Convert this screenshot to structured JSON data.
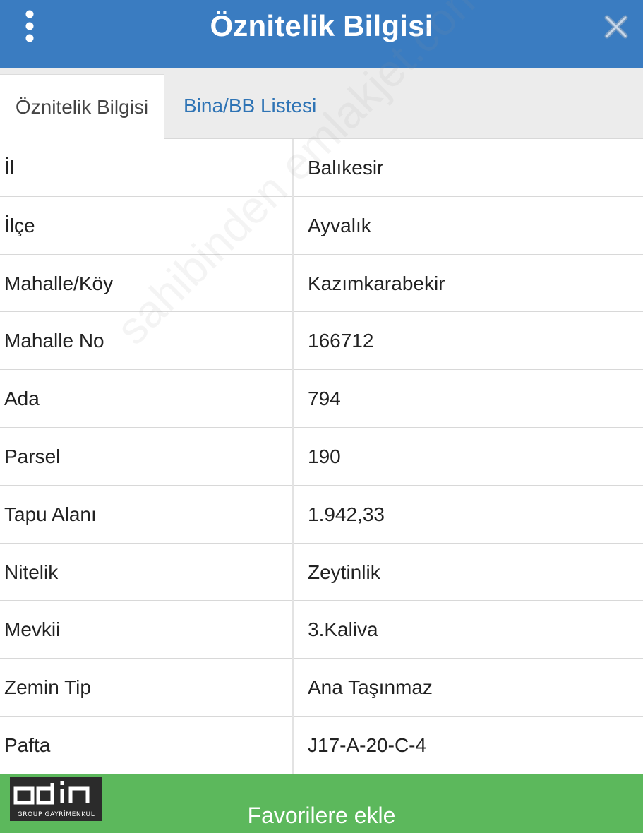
{
  "header": {
    "title": "Öznitelik Bilgisi",
    "menu_icon": "vertical-dots-icon",
    "close_icon": "close-icon",
    "background": "#3a7cc1"
  },
  "tabs": [
    {
      "label": "Öznitelik Bilgisi",
      "active": true
    },
    {
      "label": "Bina/BB Listesi",
      "active": false
    }
  ],
  "attributes": [
    {
      "label": "İl",
      "value": "Balıkesir"
    },
    {
      "label": "İlçe",
      "value": "Ayvalık"
    },
    {
      "label": "Mahalle/Köy",
      "value": "Kazımkarabekir"
    },
    {
      "label": "Mahalle No",
      "value": "166712"
    },
    {
      "label": "Ada",
      "value": "794"
    },
    {
      "label": "Parsel",
      "value": "190"
    },
    {
      "label": "Tapu Alanı",
      "value": "1.942,33"
    },
    {
      "label": "Nitelik",
      "value": "Zeytinlik"
    },
    {
      "label": "Mevkii",
      "value": "3.Kaliva"
    },
    {
      "label": "Zemin Tip",
      "value": "Ana Taşınmaz"
    },
    {
      "label": "Pafta",
      "value": "J17-A-20-C-4"
    }
  ],
  "watermark": "sahibinden emlakjet.com",
  "footer": {
    "button_label": "Favorilere ekle",
    "background": "#5cb85c",
    "logo_text": "odin",
    "logo_subtext": "GROUP GAYRİMENKUL"
  }
}
